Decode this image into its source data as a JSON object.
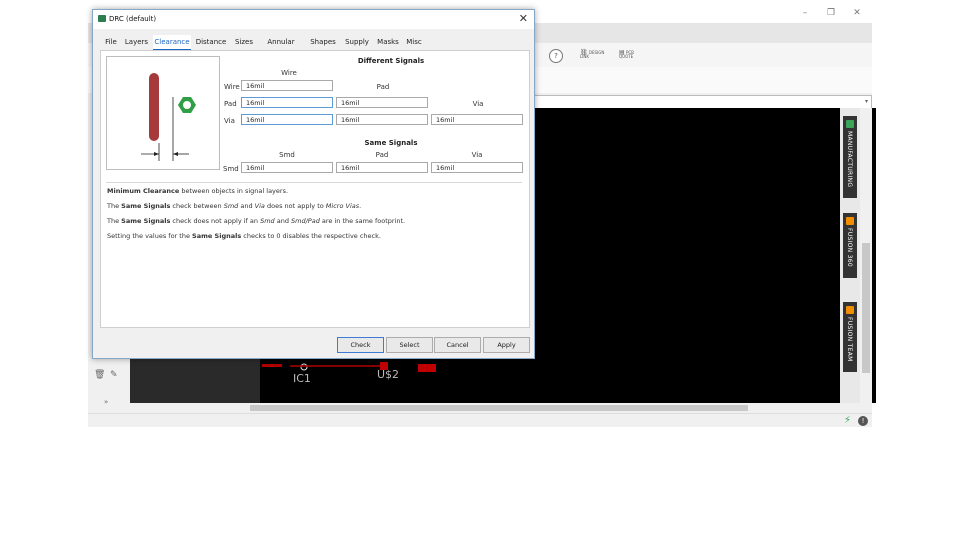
{
  "app": {
    "window_controls": {
      "minimize": "–",
      "maximize": "❐",
      "close": "✕"
    },
    "toolbar": {
      "help": "?",
      "design_link": "DESIGN LINK",
      "pcb_quote": "PCB QUOTE"
    },
    "right_tabs": [
      {
        "label": "MANUFACTURING",
        "icon_color": "#3aa55a"
      },
      {
        "label": "FUSION 360",
        "icon_color": "#f28c00"
      },
      {
        "label": "FUSION TEAM",
        "icon_color": "#f28c00"
      }
    ],
    "canvas": {
      "labels": [
        "IC1",
        "U$2"
      ]
    }
  },
  "dialog": {
    "title": "DRC (default)",
    "close": "✕",
    "tabs": [
      "File",
      "Layers",
      "Clearance",
      "Distance",
      "Sizes",
      "Annular Ring",
      "Shapes",
      "Supply",
      "Masks",
      "Misc"
    ],
    "active_tab": "Clearance",
    "different_signals": {
      "title": "Different Signals",
      "col_wire": "Wire",
      "col_pad": "Pad",
      "col_via": "Via",
      "rows": [
        {
          "label": "Wire",
          "values": [
            "16mil"
          ]
        },
        {
          "label": "Pad",
          "values": [
            "16mil",
            "16mil"
          ]
        },
        {
          "label": "Via",
          "values": [
            "16mil",
            "16mil",
            "16mil"
          ]
        }
      ]
    },
    "same_signals": {
      "title": "Same Signals",
      "col_smd": "Smd",
      "col_pad": "Pad",
      "col_via": "Via",
      "row_label": "Smd",
      "values": [
        "16mil",
        "16mil",
        "16mil"
      ]
    },
    "notes": {
      "line1": {
        "b1": "Minimum Clearance",
        "t1": " between objects in signal layers."
      },
      "line2": {
        "t1": "The ",
        "b1": "Same Signals",
        "t2": " check between ",
        "i1": "Smd",
        "t3": " and ",
        "i2": "Via",
        "t4": " does not apply to ",
        "i3": "Micro Vias",
        "t5": "."
      },
      "line3": {
        "t1": "The ",
        "b1": "Same Signals",
        "t2": " check does not apply if an ",
        "i1": "Smd",
        "t3": " and ",
        "i2": "Smd/Pad",
        "t4": " are in the same footprint."
      },
      "line4": {
        "t1": "Setting the values for the ",
        "b1": "Same Signals",
        "t2": " checks to 0 disables the respective check."
      }
    },
    "buttons": {
      "check": "Check",
      "select": "Select",
      "cancel": "Cancel",
      "apply": "Apply"
    }
  }
}
